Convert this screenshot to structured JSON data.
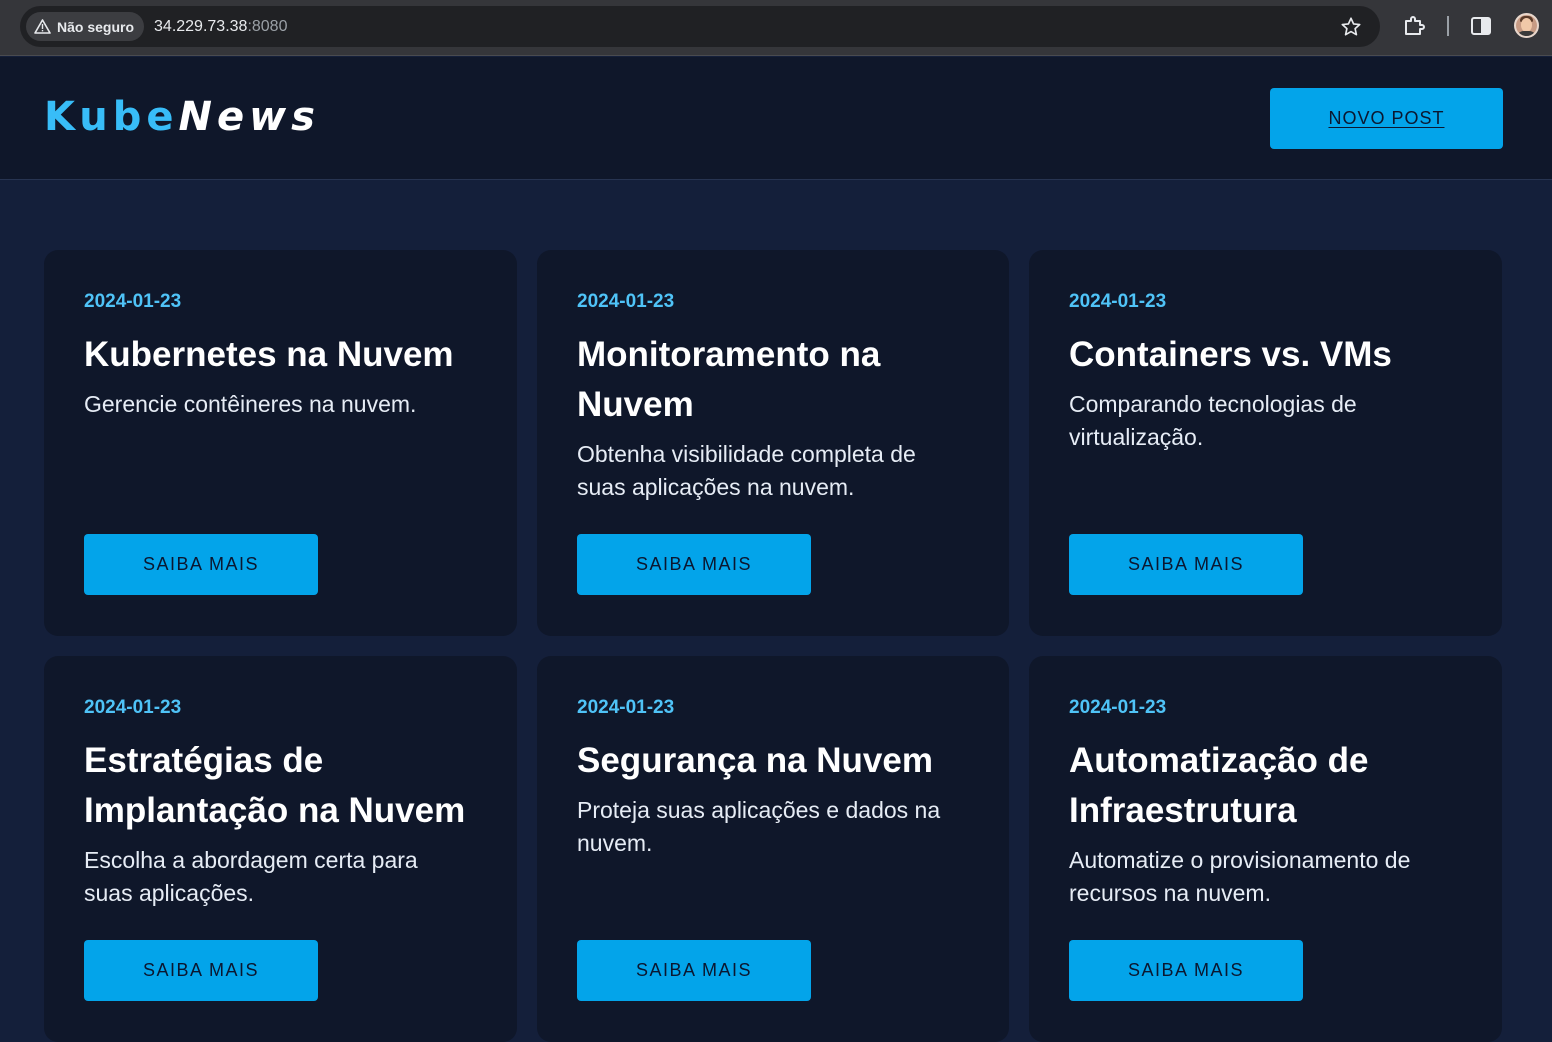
{
  "browser": {
    "security_label": "Não seguro",
    "url_host": "34.229.73.38",
    "url_port": ":8080"
  },
  "site": {
    "logo_part1": "Kube",
    "logo_part2": "News",
    "new_post_label": "NOVO POST"
  },
  "posts": [
    {
      "date": "2024-01-23",
      "title": "Kubernetes na Nuvem",
      "description": "Gerencie contêineres na nuvem.",
      "button": "SAIBA MAIS"
    },
    {
      "date": "2024-01-23",
      "title": "Monitoramento na Nuvem",
      "description": "Obtenha visibilidade completa de suas aplicações na nuvem.",
      "button": "SAIBA MAIS"
    },
    {
      "date": "2024-01-23",
      "title": "Containers vs. VMs",
      "description": "Comparando tecnologias de virtualização.",
      "button": "SAIBA MAIS"
    },
    {
      "date": "2024-01-23",
      "title": "Estratégias de Implantação na Nuvem",
      "description": "Escolha a abordagem certa para suas aplicações.",
      "button": "SAIBA MAIS"
    },
    {
      "date": "2024-01-23",
      "title": "Segurança na Nuvem",
      "description": "Proteja suas aplicações e dados na nuvem.",
      "button": "SAIBA MAIS"
    },
    {
      "date": "2024-01-23",
      "title": "Automatização de Infraestrutura",
      "description": "Automatize o provisionamento de recursos na nuvem.",
      "button": "SAIBA MAIS"
    }
  ]
}
